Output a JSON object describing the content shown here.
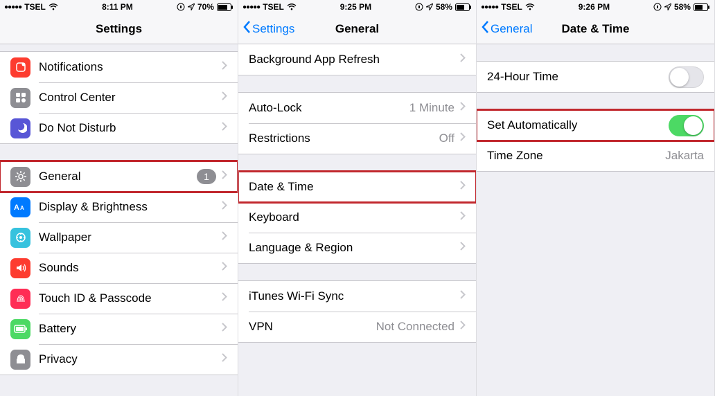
{
  "screen1": {
    "status": {
      "carrier": "TSEL",
      "time": "8:11 PM",
      "battery": "70%"
    },
    "title": "Settings",
    "group1": [
      {
        "icon": "notifications-icon",
        "label": "Notifications"
      },
      {
        "icon": "control-center-icon",
        "label": "Control Center"
      },
      {
        "icon": "dnd-icon",
        "label": "Do Not Disturb"
      }
    ],
    "group2": [
      {
        "icon": "general-icon",
        "label": "General",
        "badge": "1",
        "highlight": true
      },
      {
        "icon": "display-icon",
        "label": "Display & Brightness"
      },
      {
        "icon": "wallpaper-icon",
        "label": "Wallpaper"
      },
      {
        "icon": "sounds-icon",
        "label": "Sounds"
      },
      {
        "icon": "touchid-icon",
        "label": "Touch ID & Passcode"
      },
      {
        "icon": "battery-icon",
        "label": "Battery"
      },
      {
        "icon": "privacy-icon",
        "label": "Privacy"
      }
    ]
  },
  "screen2": {
    "status": {
      "carrier": "TSEL",
      "time": "9:25 PM",
      "battery": "58%"
    },
    "back": "Settings",
    "title": "General",
    "group1": [
      {
        "label": "Background App Refresh"
      }
    ],
    "group2": [
      {
        "label": "Auto-Lock",
        "value": "1 Minute"
      },
      {
        "label": "Restrictions",
        "value": "Off"
      }
    ],
    "group3": [
      {
        "label": "Date & Time",
        "highlight": true
      },
      {
        "label": "Keyboard"
      },
      {
        "label": "Language & Region"
      }
    ],
    "group4": [
      {
        "label": "iTunes Wi-Fi Sync"
      },
      {
        "label": "VPN",
        "value": "Not Connected"
      }
    ]
  },
  "screen3": {
    "status": {
      "carrier": "TSEL",
      "time": "9:26 PM",
      "battery": "58%"
    },
    "back": "General",
    "title": "Date & Time",
    "group1": [
      {
        "label": "24-Hour Time",
        "toggle": "off"
      }
    ],
    "group2": [
      {
        "label": "Set Automatically",
        "toggle": "on",
        "highlight": true
      },
      {
        "label": "Time Zone",
        "value": "Jakarta"
      }
    ]
  }
}
